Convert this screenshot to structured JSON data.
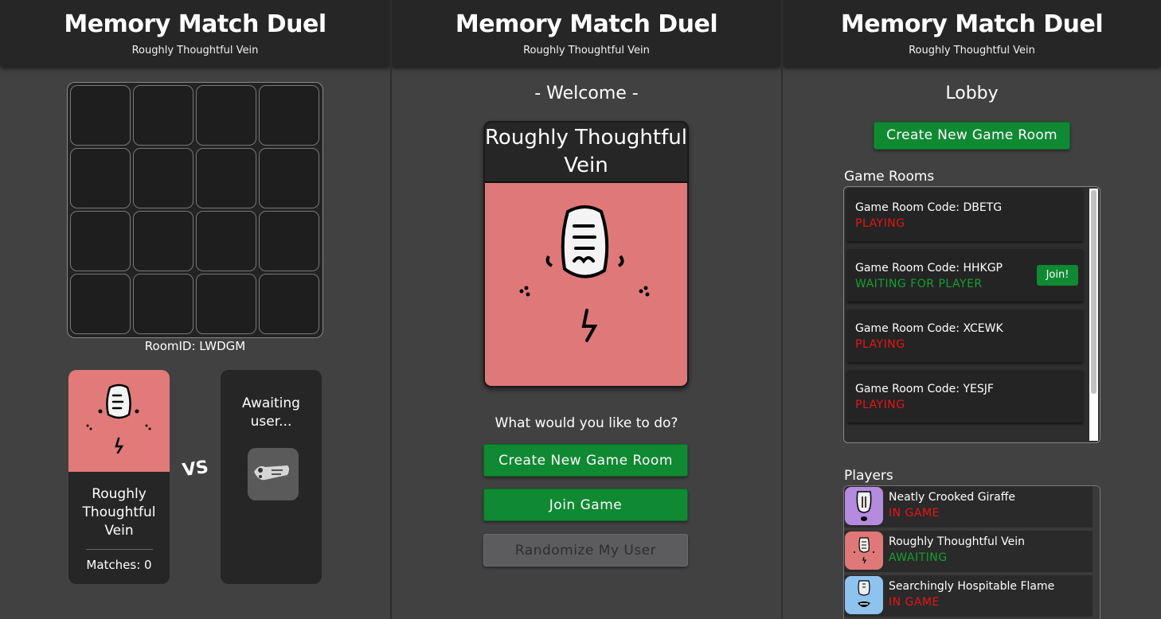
{
  "app": {
    "title": "Memory Match Duel",
    "subtitle": "Roughly Thoughtful Vein"
  },
  "colors": {
    "background": "#414141",
    "header": "#262626",
    "accent_green": "#108a32",
    "status_red": "#e81414",
    "status_green": "#12a12d",
    "avatar_pink": "#df7979",
    "avatar_purple": "#b58be0",
    "avatar_blue": "#8ec3f0"
  },
  "game": {
    "room_id": "RoomID: LWDGM",
    "tiles": 16,
    "player": {
      "name": "Roughly Thoughtful Vein",
      "matches": "Matches: 0",
      "avatar_icon": "pink-face-icon"
    },
    "vs": "VS",
    "opponent": {
      "status": "Awaiting user...",
      "placeholder_icon": "robot-placeholder-icon"
    }
  },
  "welcome": {
    "title": "- Welcome -",
    "user_name": "Roughly Thoughtful Vein",
    "question": "What would you like to do?",
    "create_button": "Create New Game Room",
    "join_button": "Join Game",
    "randomize_button": "Randomize My User"
  },
  "lobby": {
    "title": "Lobby",
    "create_button": "Create New Game Room",
    "rooms_label": "Game Rooms",
    "rooms": [
      {
        "code": "Game Room Code: DBETG",
        "status": "PLAYING",
        "status_color": "red"
      },
      {
        "code": "Game Room Code: HHKGP",
        "status": "WAITING FOR PLAYER",
        "status_color": "green",
        "join": "Join!"
      },
      {
        "code": "Game Room Code: XCEWK",
        "status": "PLAYING",
        "status_color": "red"
      },
      {
        "code": "Game Room Code: YESJF",
        "status": "PLAYING",
        "status_color": "red"
      }
    ],
    "players_label": "Players",
    "players": [
      {
        "name": "Neatly Crooked Giraffe",
        "status": "IN GAME",
        "status_color": "red",
        "avatar_color": "#b58be0"
      },
      {
        "name": "Roughly Thoughtful Vein",
        "status": "AWAITING",
        "status_color": "green",
        "avatar_color": "#df7979"
      },
      {
        "name": "Searchingly Hospitable Flame",
        "status": "IN GAME",
        "status_color": "red",
        "avatar_color": "#8ec3f0"
      }
    ]
  }
}
